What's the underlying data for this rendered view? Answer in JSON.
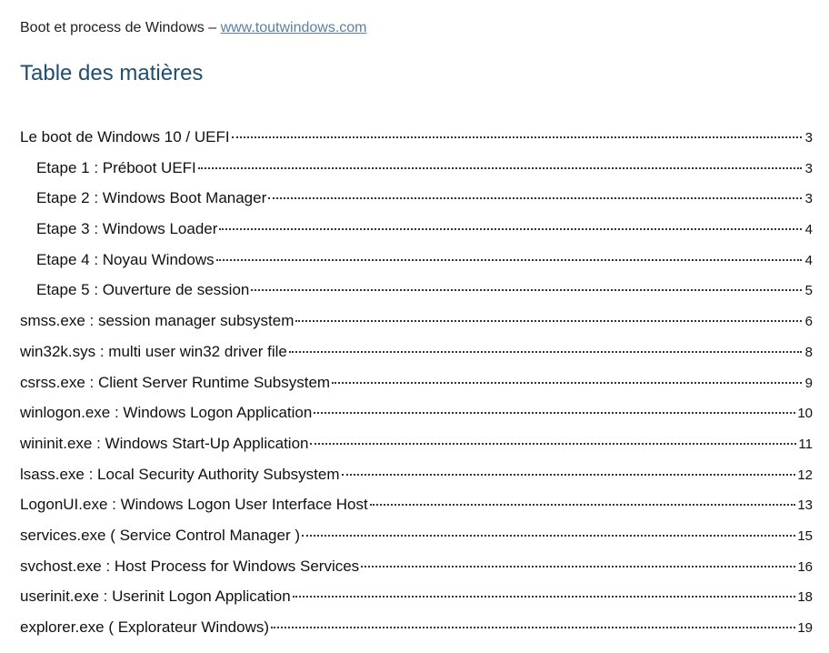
{
  "header": {
    "prefix": "Boot et process de Windows – ",
    "link_text": "www.toutwindows.com"
  },
  "toc": {
    "title": "Table des matières",
    "entries": [
      {
        "text": "Le boot de Windows 10 / UEFI ",
        "page": "3",
        "level": 1
      },
      {
        "text": "Etape 1 : Préboot UEFI",
        "page": "3",
        "level": 2
      },
      {
        "text": "Etape 2 : Windows Boot Manager ",
        "page": "3",
        "level": 2
      },
      {
        "text": "Etape 3 : Windows Loader ",
        "page": "4",
        "level": 2
      },
      {
        "text": "Etape 4 : Noyau Windows ",
        "page": "4",
        "level": 2
      },
      {
        "text": "Etape 5 : Ouverture de session ",
        "page": "5",
        "level": 2
      },
      {
        "text": "smss.exe : session manager subsystem",
        "page": "6",
        "level": 1
      },
      {
        "text": "win32k.sys : multi user win32 driver file ",
        "page": "8",
        "level": 1
      },
      {
        "text": "csrss.exe : Client Server Runtime Subsystem",
        "page": "9",
        "level": 1
      },
      {
        "text": "winlogon.exe : Windows Logon Application ",
        "page": "10",
        "level": 1
      },
      {
        "text": "wininit.exe : Windows Start-Up Application",
        "page": "11",
        "level": 1
      },
      {
        "text": "lsass.exe : Local Security Authority Subsystem ",
        "page": "12",
        "level": 1
      },
      {
        "text": "LogonUI.exe : Windows Logon User Interface Host",
        "page": "13",
        "level": 1
      },
      {
        "text": "services.exe ( Service Control Manager ) ",
        "page": "15",
        "level": 1
      },
      {
        "text": "svchost.exe : Host Process for Windows Services ",
        "page": "16",
        "level": 1
      },
      {
        "text": "userinit.exe : Userinit Logon Application ",
        "page": "18",
        "level": 1
      },
      {
        "text": "explorer.exe ( Explorateur Windows)",
        "page": "19",
        "level": 1
      }
    ]
  }
}
